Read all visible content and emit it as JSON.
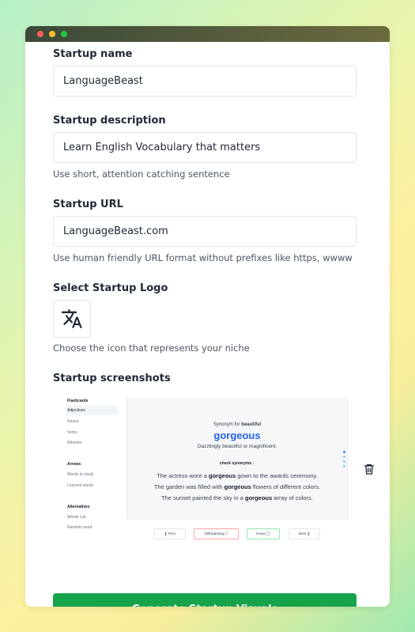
{
  "window": {
    "controls": [
      "close",
      "minimize",
      "maximize"
    ]
  },
  "form": {
    "name": {
      "label": "Startup name",
      "value": "LanguageBeast"
    },
    "description": {
      "label": "Startup description",
      "value": "Learn English Vocabulary that matters",
      "hint": "Use short, attention catching sentence"
    },
    "url": {
      "label": "Startup URL",
      "value": "LanguageBeast.com",
      "hint": "Use human friendly URL format without prefixes like https, wwww"
    },
    "logo": {
      "label": "Select Startup Logo",
      "icon": "translate-icon",
      "hint": "Choose the icon that represents your niche"
    },
    "screenshots": {
      "label": "Startup screenshots",
      "delete_icon": "trash-icon"
    },
    "submit_label": "Generate Startup Visuals"
  },
  "screenshot_preview": {
    "sidebar": {
      "section1": "Flashcards",
      "items1": [
        "Adjectives",
        "Nouns",
        "Verbs",
        "Adverbs"
      ],
      "section2": "Arrows",
      "items2": [
        "Words to study",
        "Learned words"
      ],
      "section3": "Alternatives",
      "items3": [
        "Words List",
        "Random word"
      ]
    },
    "card": {
      "synonym_prefix": "Synonym for ",
      "synonym_word": "beautiful",
      "word": "gorgeous",
      "meaning": "Dazzlingly beautiful or magnificent.",
      "check": "check synonyms ↓",
      "ex1_pre": "The actress wore a ",
      "ex1_word": "gorgeous",
      "ex1_post": " gown to the awards ceremony.",
      "ex2_pre": "The garden was filled with ",
      "ex2_word": "gorgeous",
      "ex2_post": " flowers of different colors.",
      "ex3_pre": "The sunset painted the sky in a ",
      "ex3_word": "gorgeous",
      "ex3_post": " array of colors."
    },
    "buttons": {
      "prev": "❮ Prev",
      "still": "Still learning ☐",
      "know": "Know ◯",
      "next": "Next ❯"
    }
  },
  "colors": {
    "primary_button": "#16a34a",
    "accent_word": "#2563eb"
  }
}
